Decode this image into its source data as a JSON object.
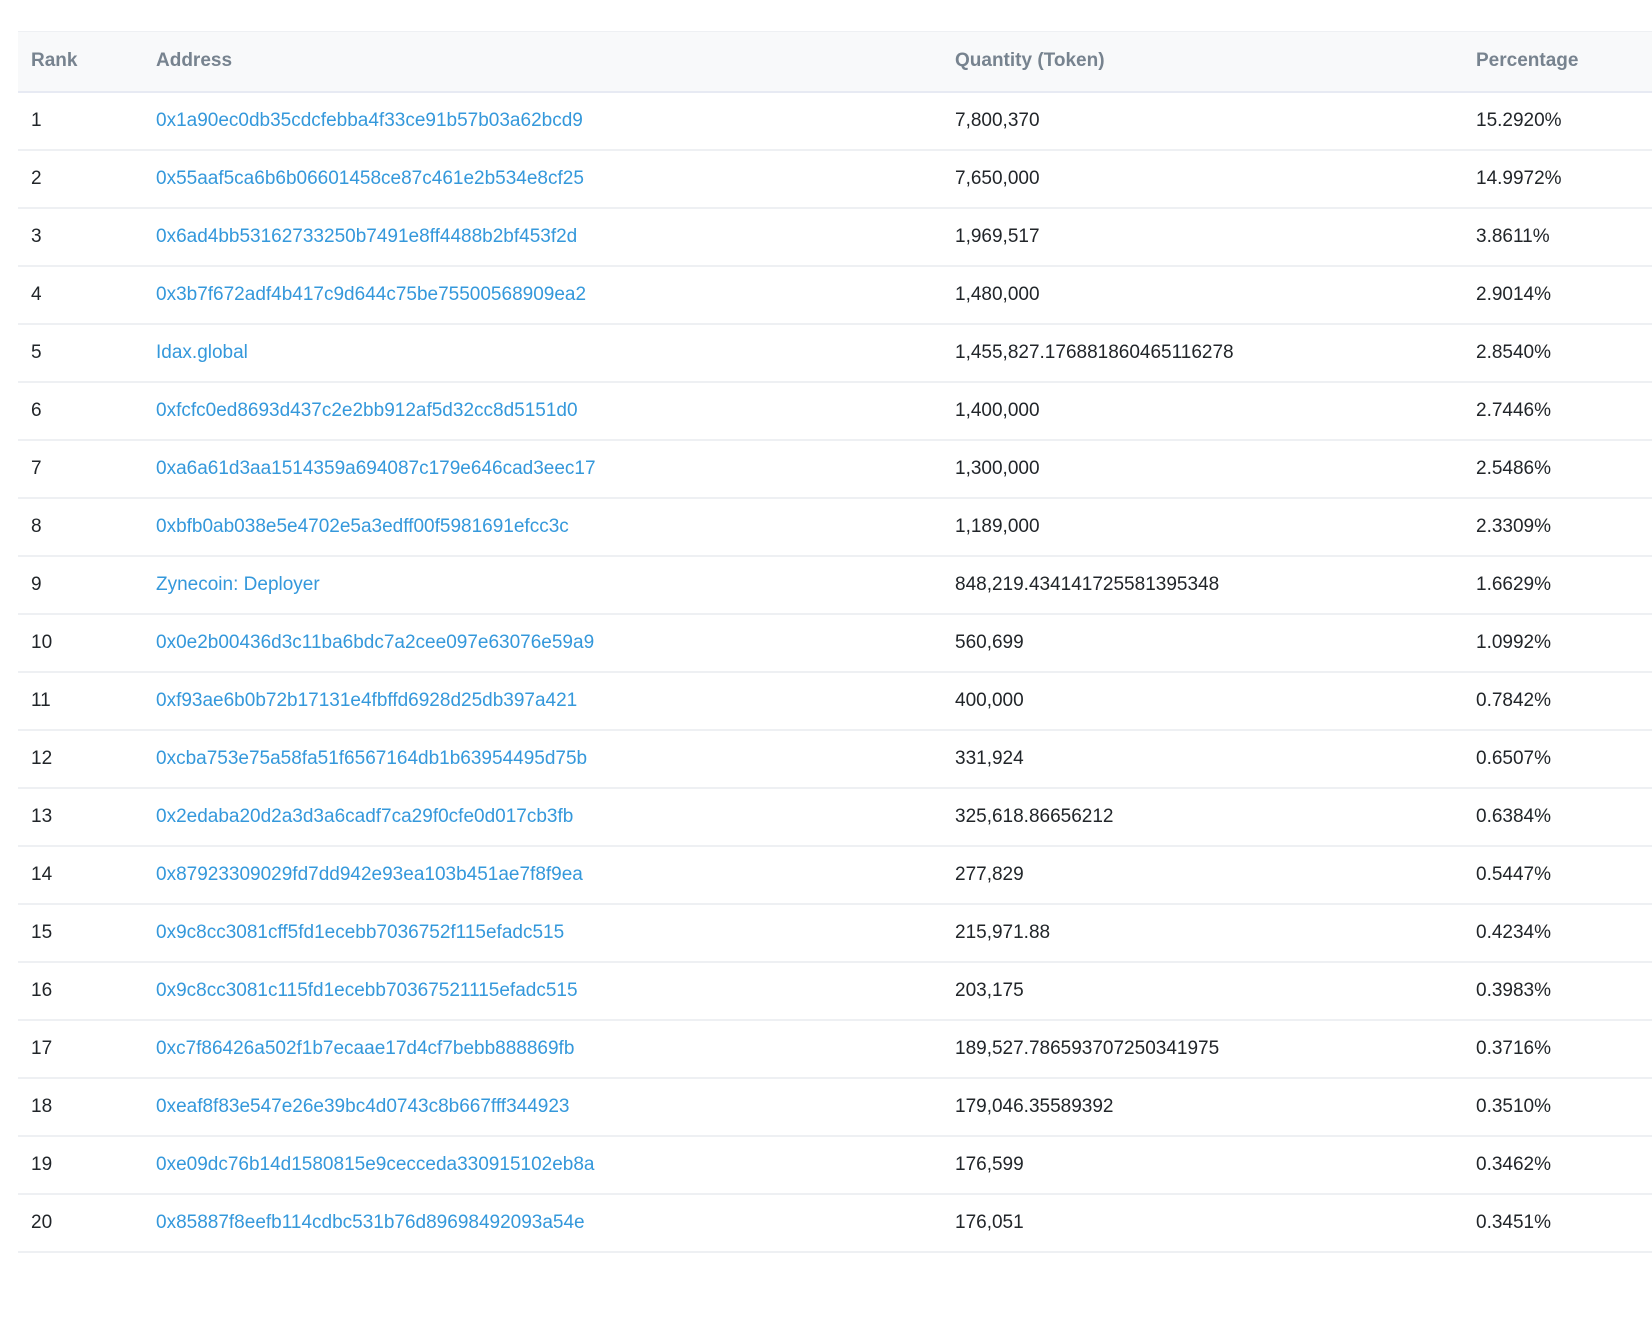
{
  "table": {
    "headers": {
      "rank": "Rank",
      "address": "Address",
      "quantity": "Quantity (Token)",
      "percentage": "Percentage"
    },
    "rows": [
      {
        "rank": "1",
        "address": "0x1a90ec0db35cdcfebba4f33ce91b57b03a62bcd9",
        "quantity": "7,800,370",
        "percentage": "15.2920%"
      },
      {
        "rank": "2",
        "address": "0x55aaf5ca6b6b06601458ce87c461e2b534e8cf25",
        "quantity": "7,650,000",
        "percentage": "14.9972%"
      },
      {
        "rank": "3",
        "address": "0x6ad4bb53162733250b7491e8ff4488b2bf453f2d",
        "quantity": "1,969,517",
        "percentage": "3.8611%"
      },
      {
        "rank": "4",
        "address": "0x3b7f672adf4b417c9d644c75be75500568909ea2",
        "quantity": "1,480,000",
        "percentage": "2.9014%"
      },
      {
        "rank": "5",
        "address": "Idax.global",
        "quantity": "1,455,827.176881860465116278",
        "percentage": "2.8540%"
      },
      {
        "rank": "6",
        "address": "0xfcfc0ed8693d437c2e2bb912af5d32cc8d5151d0",
        "quantity": "1,400,000",
        "percentage": "2.7446%"
      },
      {
        "rank": "7",
        "address": "0xa6a61d3aa1514359a694087c179e646cad3eec17",
        "quantity": "1,300,000",
        "percentage": "2.5486%"
      },
      {
        "rank": "8",
        "address": "0xbfb0ab038e5e4702e5a3edff00f5981691efcc3c",
        "quantity": "1,189,000",
        "percentage": "2.3309%"
      },
      {
        "rank": "9",
        "address": "Zynecoin: Deployer",
        "quantity": "848,219.434141725581395348",
        "percentage": "1.6629%"
      },
      {
        "rank": "10",
        "address": "0x0e2b00436d3c11ba6bdc7a2cee097e63076e59a9",
        "quantity": "560,699",
        "percentage": "1.0992%"
      },
      {
        "rank": "11",
        "address": "0xf93ae6b0b72b17131e4fbffd6928d25db397a421",
        "quantity": "400,000",
        "percentage": "0.7842%"
      },
      {
        "rank": "12",
        "address": "0xcba753e75a58fa51f6567164db1b63954495d75b",
        "quantity": "331,924",
        "percentage": "0.6507%"
      },
      {
        "rank": "13",
        "address": "0x2edaba20d2a3d3a6cadf7ca29f0cfe0d017cb3fb",
        "quantity": "325,618.86656212",
        "percentage": "0.6384%"
      },
      {
        "rank": "14",
        "address": "0x87923309029fd7dd942e93ea103b451ae7f8f9ea",
        "quantity": "277,829",
        "percentage": "0.5447%"
      },
      {
        "rank": "15",
        "address": "0x9c8cc3081cff5fd1ecebb7036752f115efadc515",
        "quantity": "215,971.88",
        "percentage": "0.4234%"
      },
      {
        "rank": "16",
        "address": "0x9c8cc3081c115fd1ecebb70367521115efadc515",
        "quantity": "203,175",
        "percentage": "0.3983%"
      },
      {
        "rank": "17",
        "address": "0xc7f86426a502f1b7ecaae17d4cf7bebb888869fb",
        "quantity": "189,527.786593707250341975",
        "percentage": "0.3716%"
      },
      {
        "rank": "18",
        "address": "0xeaf8f83e547e26e39bc4d0743c8b667fff344923",
        "quantity": "179,046.35589392",
        "percentage": "0.3510%"
      },
      {
        "rank": "19",
        "address": "0xe09dc76b14d1580815e9cecceda330915102eb8a",
        "quantity": "176,599",
        "percentage": "0.3462%"
      },
      {
        "rank": "20",
        "address": "0x85887f8eefb114cdbc531b76d89698492093a54e",
        "quantity": "176,051",
        "percentage": "0.3451%"
      }
    ]
  },
  "colors": {
    "link": "#3498db",
    "header_text": "#77838f",
    "body_text": "#212529",
    "header_bg": "#f8f9fa",
    "row_border": "#eef0f3"
  }
}
